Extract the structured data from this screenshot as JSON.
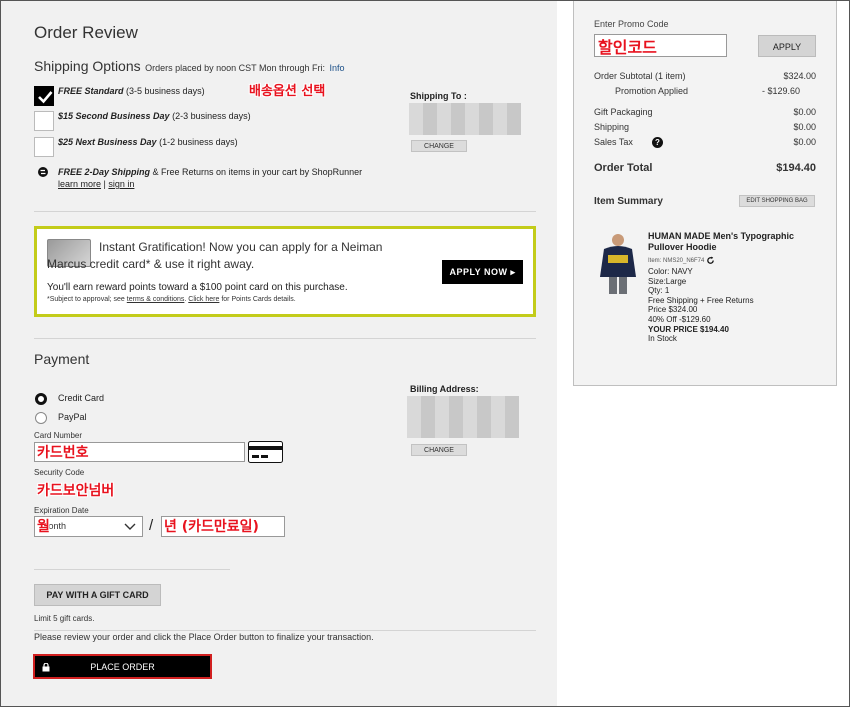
{
  "title": "Order Review",
  "shipping": {
    "heading": "Shipping Options",
    "note": "Orders placed by noon CST Mon through Fri:",
    "note_link": "Info",
    "annotation": "배송옵션 선택",
    "options": [
      {
        "label": "FREE Standard",
        "detail": "(3-5 business days)"
      },
      {
        "label": "$15 Second Business Day",
        "detail": "(2-3 business days)"
      },
      {
        "label": "$25 Next Business Day",
        "detail": "(1-2 business days)"
      }
    ],
    "shoprunner_bold": "FREE 2-Day Shipping",
    "shoprunner_text": "& Free Returns on items in your cart by ShopRunner",
    "learn_more": "learn more",
    "sign_in": "sign in",
    "separator": "|",
    "ship_to_label": "Shipping To :",
    "change_label": "CHANGE"
  },
  "promo_card": {
    "headline_line1": "Instant Gratification! Now you can apply for a Neiman",
    "headline_line2": "Marcus credit card* & use it right away.",
    "reward_text": "You'll earn reward points toward a $100 point card on this purchase.",
    "fine_print_prefix": "*Subject to approval; see",
    "terms_link": "terms & conditions",
    "click_here": "Click here",
    "fine_print_suffix": "for Points Cards details.",
    "apply_button": "APPLY NOW ▸"
  },
  "payment": {
    "heading": "Payment",
    "methods": [
      "Credit Card",
      "PayPal"
    ],
    "card_number_label": "Card Number",
    "card_number_annotation": "카드번호",
    "security_code_label": "Security Code",
    "security_code_annotation": "카드보안넘버",
    "expiration_label": "Expiration Date",
    "month_placeholder": "Month",
    "month_annotation": "월",
    "slash": "/",
    "year_annotation": "년 (카드만료일)",
    "billing_label": "Billing Address:",
    "change_label": "CHANGE",
    "gift_card_button": "PAY WITH A GIFT CARD",
    "gift_card_limit": "Limit 5 gift cards.",
    "review_note": "Please review your order and click the Place Order button to finalize your transaction.",
    "place_order": "PLACE ORDER"
  },
  "sidebar": {
    "promo_label": "Enter Promo Code",
    "promo_annotation": "할인코드",
    "apply_label": "APPLY",
    "subtotal_label": "Order Subtotal (1 item)",
    "subtotal_value": "$324.00",
    "promotion_label": "Promotion Applied",
    "promotion_value": "- $129.60",
    "gift_packaging_label": "Gift Packaging",
    "gift_packaging_value": "$0.00",
    "shipping_label": "Shipping",
    "shipping_value": "$0.00",
    "tax_label": "Sales Tax",
    "tax_value": "$0.00",
    "help_icon": "?",
    "total_label": "Order Total",
    "total_value": "$194.40",
    "item_summary_label": "Item Summary",
    "edit_bag_label": "EDIT SHOPPING BAG",
    "item": {
      "name_line1": "HUMAN MADE Men's Typographic",
      "name_line2": "Pullover Hoodie",
      "item_no": "Item: NMS20_N6F74",
      "color": "Color: NAVY",
      "size": "Size:Large",
      "qty": "Qty: 1",
      "shipping": "Free Shipping + Free Returns",
      "price": "Price $324.00",
      "discount": "40% Off -$129.60",
      "your_price": "YOUR PRICE $194.40",
      "stock": "In Stock"
    }
  },
  "colors": {
    "annotation": "#e8121e",
    "promo_border": "#c3cc1a",
    "link": "#1a4f88",
    "place_order_bg": "#000000"
  }
}
